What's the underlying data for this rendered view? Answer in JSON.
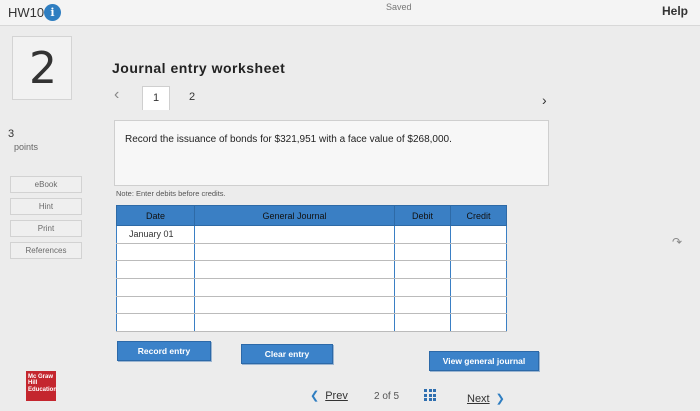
{
  "header": {
    "title": "HW10",
    "info_icon": "i",
    "status": "Saved",
    "help": "Help"
  },
  "question": {
    "number": "2",
    "points_value": "3",
    "points_label": "points"
  },
  "sidebar": {
    "items": [
      {
        "label": "eBook"
      },
      {
        "label": "Hint"
      },
      {
        "label": "Print"
      },
      {
        "label": "References"
      }
    ]
  },
  "worksheet": {
    "title": "Journal entry worksheet",
    "tabs": [
      "1",
      "2"
    ],
    "instruction": "Record the issuance of bonds for $321,951 with a face value of $268,000.",
    "note": "Note: Enter debits before credits."
  },
  "journal_table": {
    "headers": [
      "Date",
      "General Journal",
      "Debit",
      "Credit"
    ],
    "rows": [
      [
        "January 01",
        "",
        "",
        ""
      ],
      [
        "",
        "",
        "",
        ""
      ],
      [
        "",
        "",
        "",
        ""
      ],
      [
        "",
        "",
        "",
        ""
      ],
      [
        "",
        "",
        "",
        ""
      ],
      [
        "",
        "",
        "",
        ""
      ]
    ]
  },
  "buttons": {
    "record": "Record entry",
    "clear": "Clear entry",
    "view": "View general journal"
  },
  "footer": {
    "logo_text": "Mc Graw Hill Education",
    "prev": "Prev",
    "page_current": "2",
    "page_sep": "of",
    "page_total": "5",
    "next": "Next"
  }
}
